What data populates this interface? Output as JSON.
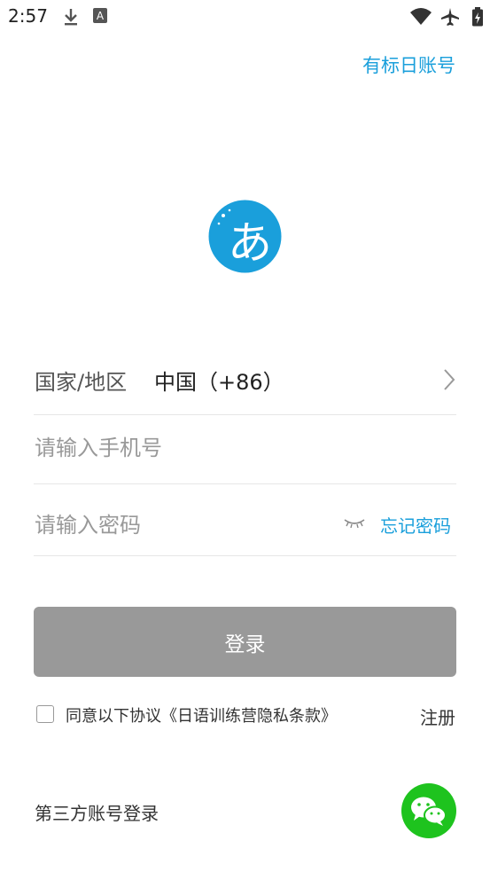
{
  "status_bar": {
    "time": "2:57",
    "icons": [
      "download-icon",
      "a-icon",
      "wifi-icon",
      "airplane-icon",
      "battery-icon"
    ]
  },
  "header": {
    "existing_account_link": "有标日账号"
  },
  "logo": {
    "glyph": "あ",
    "color": "#1a9fdb"
  },
  "form": {
    "region_label": "国家/地区",
    "region_value": "中国（+86）",
    "phone_placeholder": "请输入手机号",
    "password_placeholder": "请输入密码",
    "forgot_password": "忘记密码"
  },
  "login_button": "登录",
  "agreement": {
    "checked": false,
    "text": "同意以下协议《日语训练营隐私条款》"
  },
  "register_link": "注册",
  "third_party": {
    "label": "第三方账号登录",
    "wechat_icon": "wechat-icon"
  },
  "colors": {
    "accent": "#1a9fdb",
    "button": "#999999",
    "wechat": "#1ec31e"
  }
}
